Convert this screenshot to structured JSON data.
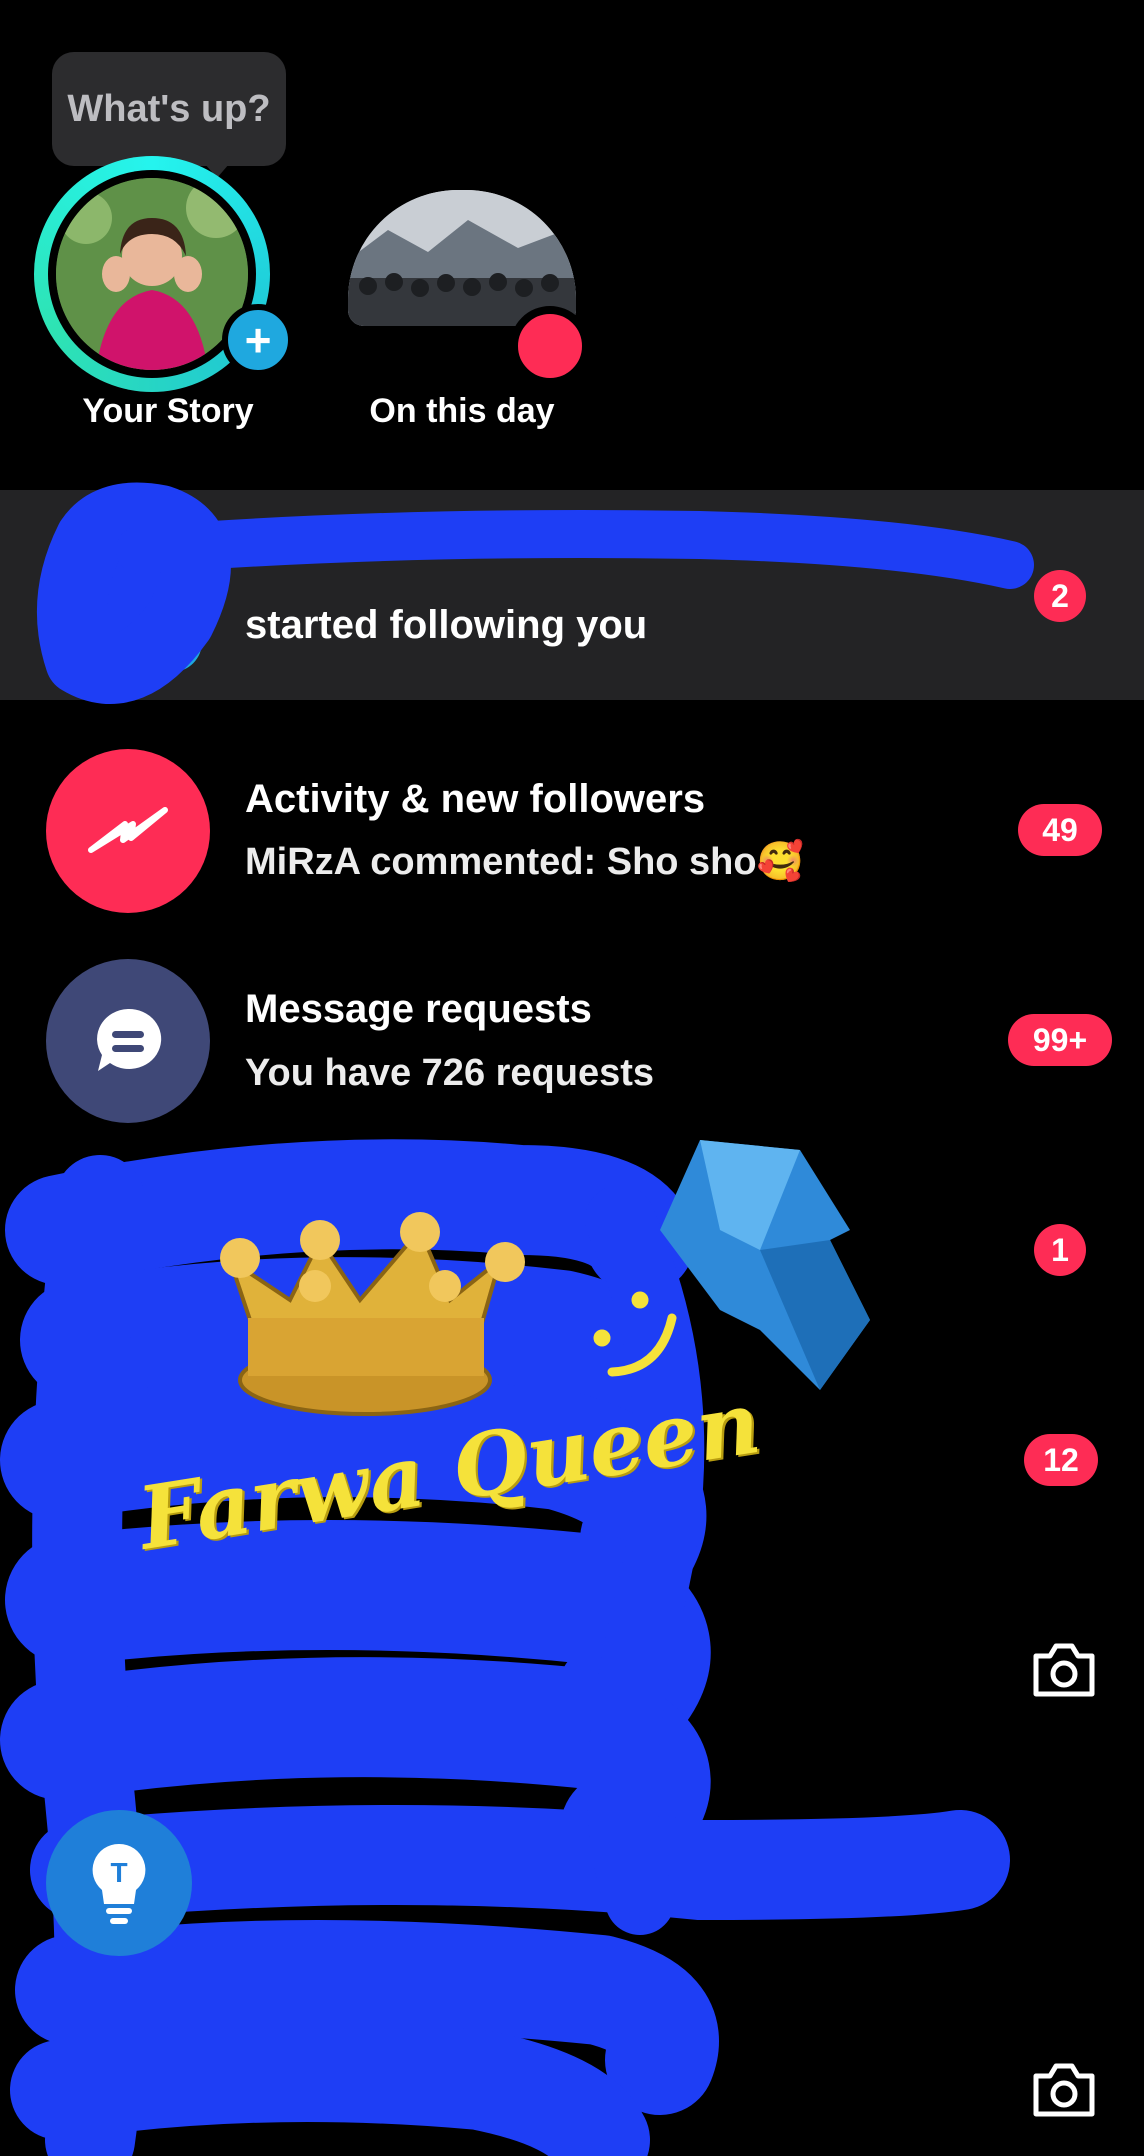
{
  "stories": {
    "tooltip": "What's up?",
    "items": [
      {
        "label": "Your Story"
      },
      {
        "label": "On this day"
      }
    ]
  },
  "banner": {
    "text": "started following you",
    "count": "2"
  },
  "inbox": [
    {
      "title": "Activity & new followers",
      "subtitle": "MiRzA commented: Sho sho🥰",
      "count": "49",
      "icon": "lightning-icon",
      "color": "#fe2c55"
    },
    {
      "title": "Message requests",
      "subtitle": "You have 726 requests",
      "count": "99+",
      "icon": "message-bubble-icon",
      "color": "#3f4877"
    }
  ],
  "hidden_rows": [
    {
      "count": "1"
    },
    {
      "count": "12"
    }
  ],
  "sticker_text": "Farwa Queen",
  "colors": {
    "accent": "#fe2c55",
    "story_ring": "#25f4ee",
    "scribble": "#1e3ef5"
  }
}
